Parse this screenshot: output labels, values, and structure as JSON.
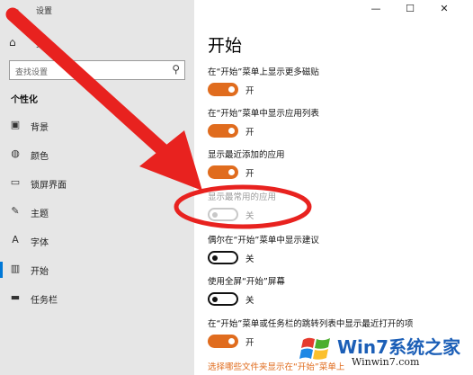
{
  "window": {
    "title": "设置",
    "back_icon": "←",
    "minimize_icon": "—",
    "maximize_icon": "☐",
    "close_icon": "✕"
  },
  "sidebar": {
    "home_icon": "⌂",
    "home_label": "页",
    "search_placeholder": "查找设置",
    "search_icon": "⚲",
    "section_title": "个性化",
    "items": [
      {
        "label": "背景",
        "icon": "▣"
      },
      {
        "label": "颜色",
        "icon": "◍"
      },
      {
        "label": "锁屏界面",
        "icon": "▭"
      },
      {
        "label": "主题",
        "icon": "✎"
      },
      {
        "label": "字体",
        "icon": "A"
      },
      {
        "label": "开始",
        "icon": "▥"
      },
      {
        "label": "任务栏",
        "icon": "▬"
      }
    ],
    "active_index": 5
  },
  "main": {
    "title": "开始",
    "settings": [
      {
        "label": "在“开始”菜单上显示更多磁贴",
        "state": "开",
        "on": true,
        "disabled": false
      },
      {
        "label": "在“开始”菜单中显示应用列表",
        "state": "开",
        "on": true,
        "disabled": false
      },
      {
        "label": "显示最近添加的应用",
        "state": "开",
        "on": true,
        "disabled": false
      },
      {
        "label": "显示最常用的应用",
        "state": "关",
        "on": false,
        "disabled": true
      },
      {
        "label": "偶尔在“开始”菜单中显示建议",
        "state": "关",
        "on": false,
        "disabled": false
      },
      {
        "label": "使用全屏“开始”屏幕",
        "state": "关",
        "on": false,
        "disabled": false
      },
      {
        "label": "在“开始”菜单或任务栏的跳转列表中显示最近打开的项",
        "state": "开",
        "on": true,
        "disabled": false
      }
    ],
    "link": "选择哪些文件夹显示在“开始”菜单上"
  },
  "watermark": {
    "title": "Win7系统之家",
    "url": "Winwin7.com"
  },
  "colors": {
    "accent": "#e06c1e",
    "annotation": "#e8221f",
    "sidebar_bg": "#e6e6e6"
  }
}
